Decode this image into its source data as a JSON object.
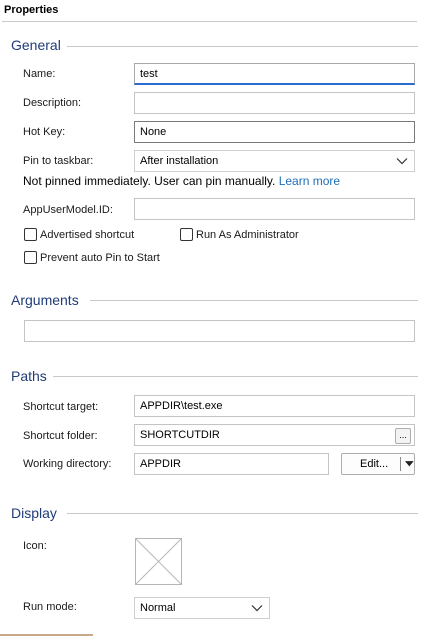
{
  "panel": {
    "title": "Properties"
  },
  "general": {
    "title": "General",
    "name_label": "Name:",
    "name_value": "test",
    "description_label": "Description:",
    "description_value": "",
    "hotkey_label": "Hot Key:",
    "hotkey_value": "None",
    "pin_label": "Pin to taskbar:",
    "pin_value": "After installation",
    "pin_info": "Not pinned immediately. User can pin manually.",
    "pin_learn_more": "Learn more",
    "appusermodel_label": "AppUserModel.ID:",
    "appusermodel_value": "",
    "advertised_label": "Advertised shortcut",
    "advertised_checked": false,
    "runas_label": "Run As Administrator",
    "runas_checked": false,
    "prevent_pin_label": "Prevent auto Pin to Start",
    "prevent_pin_checked": false
  },
  "arguments": {
    "title": "Arguments",
    "value": ""
  },
  "paths": {
    "title": "Paths",
    "target_label": "Shortcut target:",
    "target_value": "APPDIR\\test.exe",
    "folder_label": "Shortcut folder:",
    "folder_value": "SHORTCUTDIR",
    "browse_label": "...",
    "workdir_label": "Working directory:",
    "workdir_value": "APPDIR",
    "edit_label": "Edit..."
  },
  "display": {
    "title": "Display",
    "icon_label": "Icon:",
    "runmode_label": "Run mode:",
    "runmode_value": "Normal"
  },
  "colors": {
    "section_title": "#1f3b78",
    "link": "#1f6fb8",
    "focus_underline": "#2a6ccf"
  }
}
